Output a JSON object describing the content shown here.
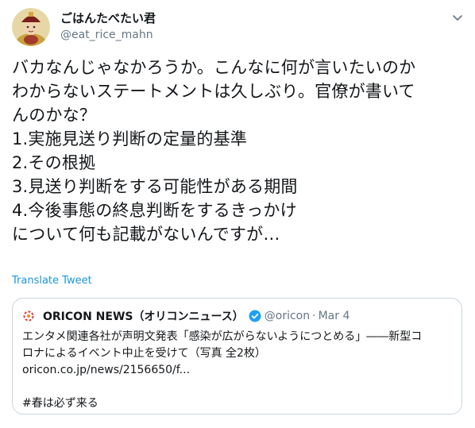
{
  "user": {
    "display_name": "ごはんたべたい君",
    "handle": "@eat_rice_mahn"
  },
  "tweet": {
    "text": "バカなんじゃなかろうか。こんなに何が言いたいのか\nわからないステートメントは久しぶり。官僚が書いて\nんのかな？\n1.実施見送り判断の定量的基準\n2.その根拠\n3.見送り判断をする可能性がある期間\n4.今後事態の終息判断をするきっかけ\nについて何も記載がないんですが…"
  },
  "translate_label": "Translate Tweet",
  "quoted": {
    "name": "ORICON NEWS（オリコンニュース）",
    "handle": "@oricon",
    "separator": "·",
    "date": "Mar 4",
    "text": "エンタメ関連各社が声明文発表「感染が広がらないようにつとめる」――新型コ\nロナによるイベント中止を受けて（写真 全2枚）\noricon.co.jp/news/2156650/f...\n\n#春は必ず来る"
  },
  "icons": {
    "caret": "chevron-down-icon",
    "verified": "verified-badge-icon",
    "logo": "oricon-logo-icon"
  },
  "colors": {
    "link": "#1b95e0",
    "verified": "#1da1f2",
    "muted": "#657786",
    "border": "#ccd6dd"
  }
}
